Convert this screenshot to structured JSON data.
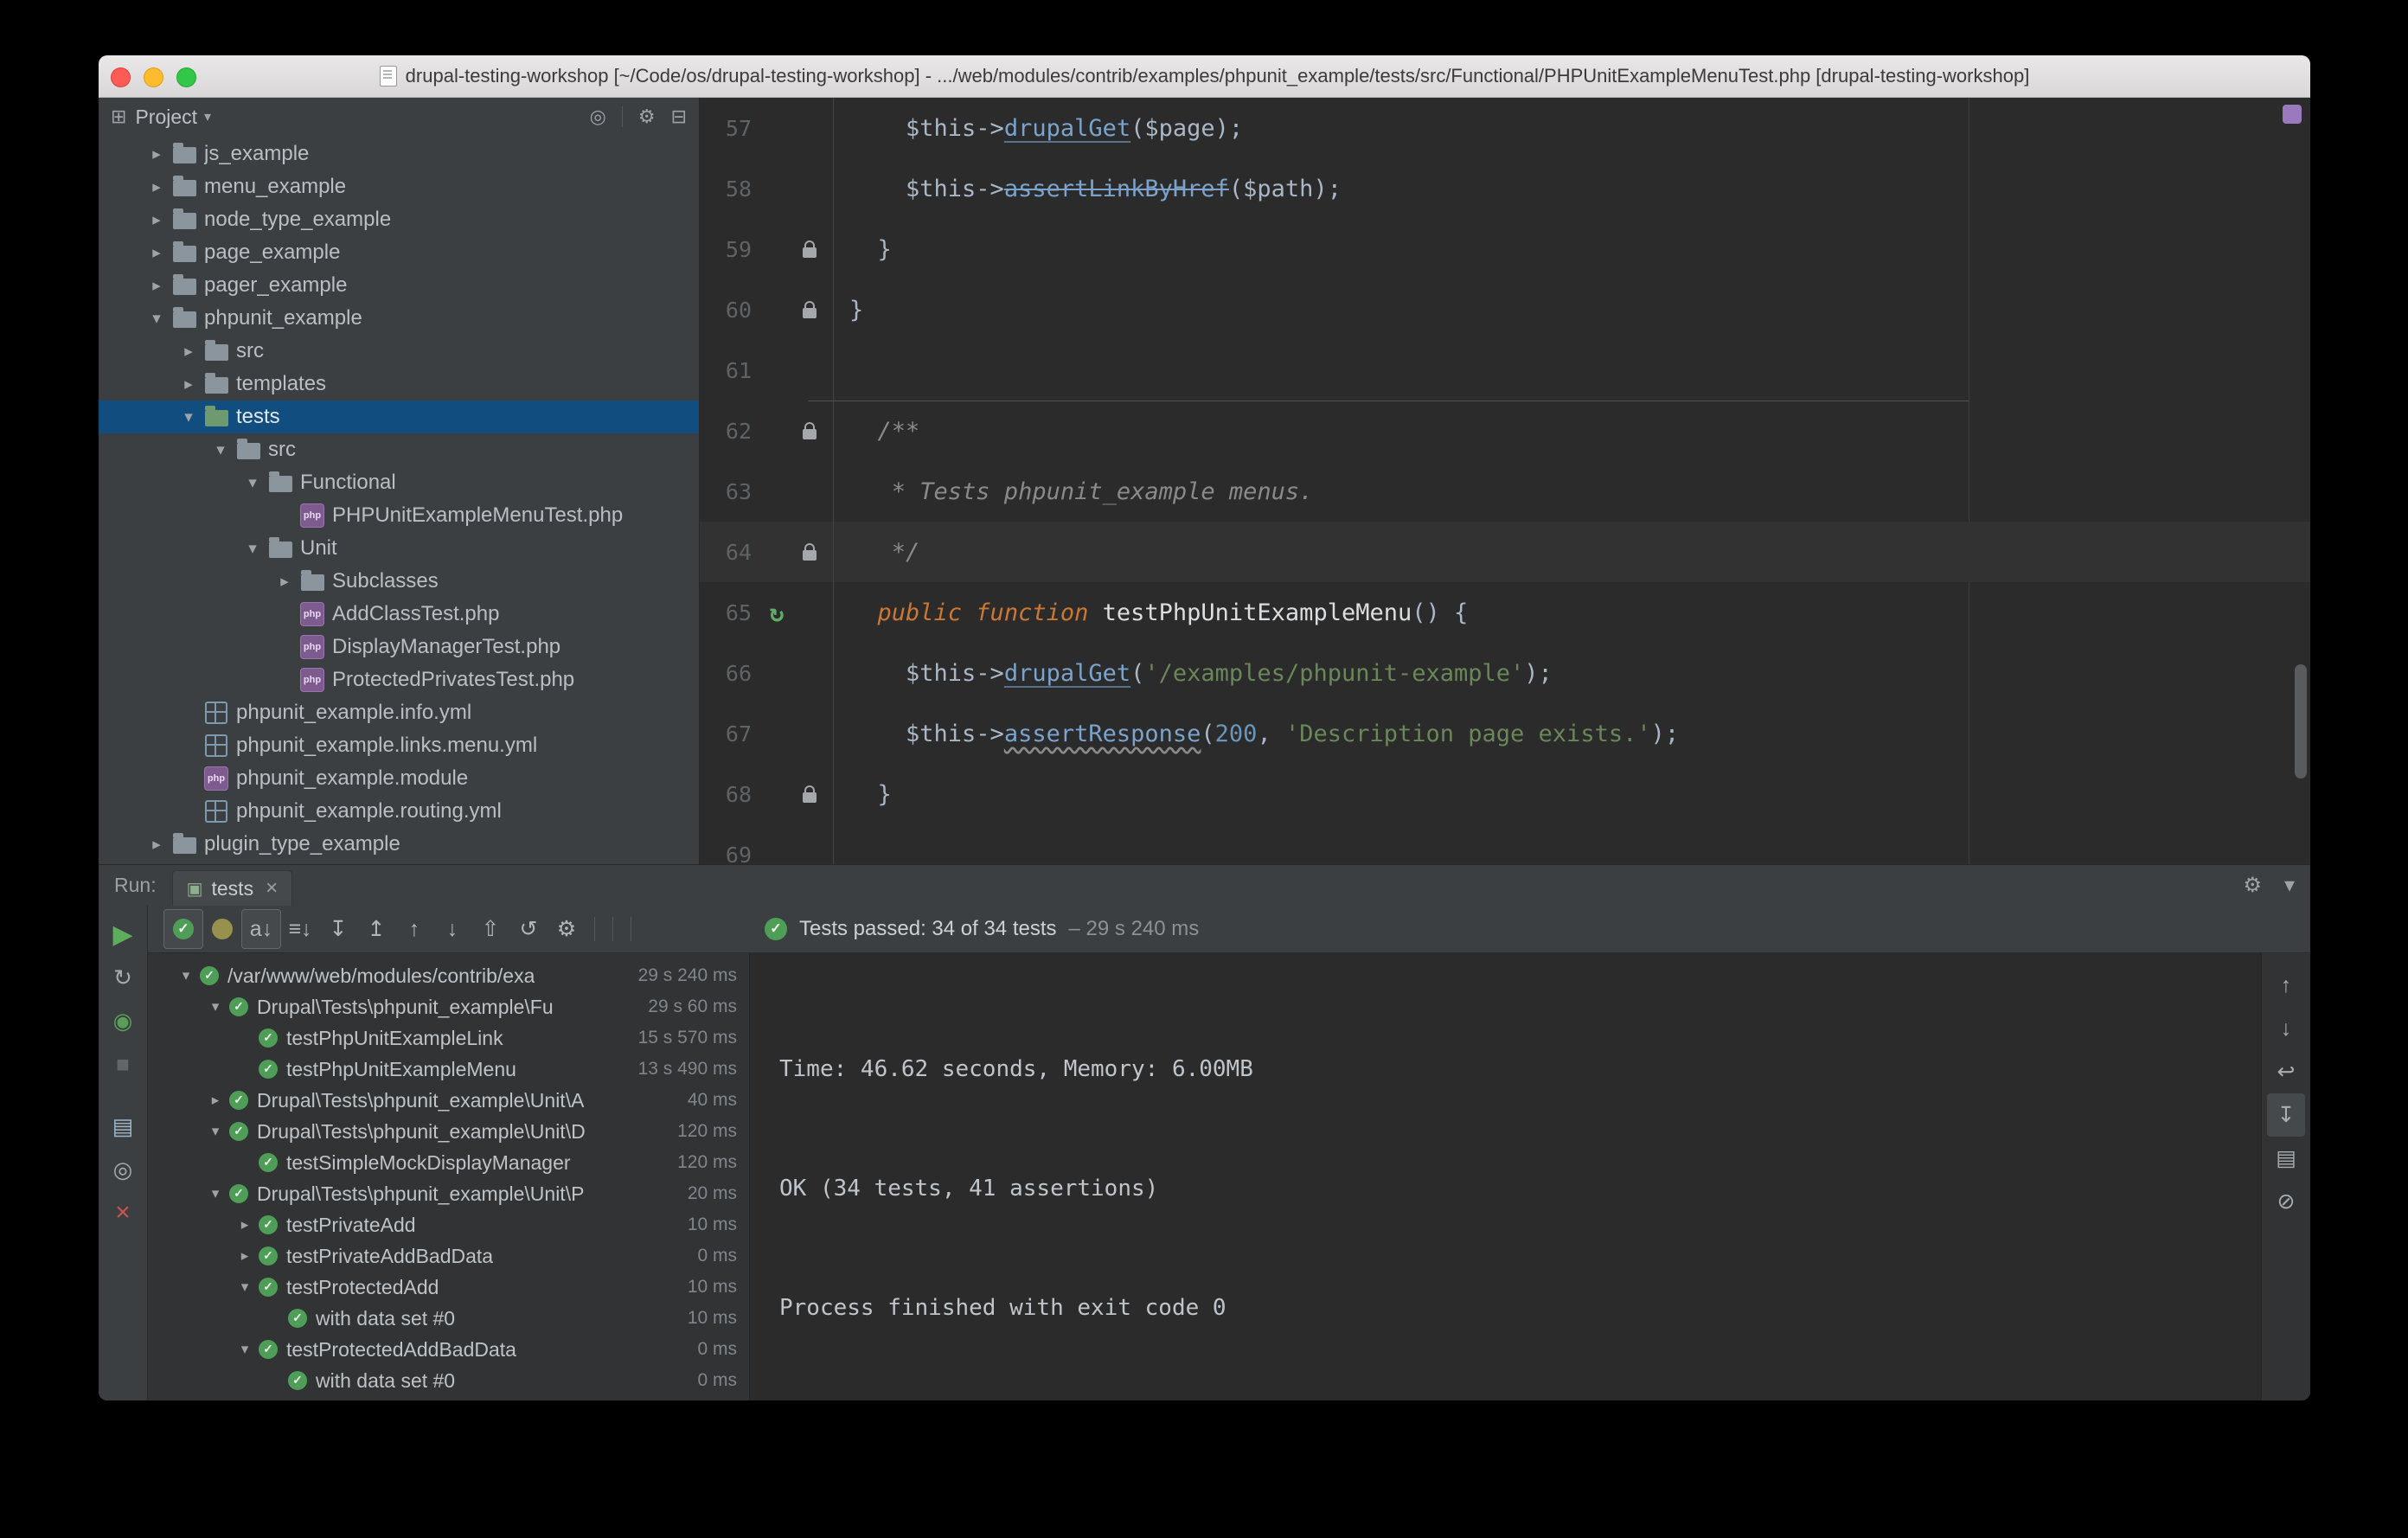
{
  "window": {
    "title": "drupal-testing-workshop [~/Code/os/drupal-testing-workshop] - .../web/modules/contrib/examples/phpunit_example/tests/src/Functional/PHPUnitExampleMenuTest.php [drupal-testing-workshop]"
  },
  "project_panel": {
    "title": "Project",
    "header_icons": [
      {
        "name": "select-opened-file-button",
        "glyph": "◎"
      },
      {
        "name": "separator"
      },
      {
        "name": "settings-gear-button",
        "glyph": "⚙"
      },
      {
        "name": "hide-panel-button",
        "glyph": "⊟"
      }
    ],
    "tree": [
      {
        "label": "js_example",
        "icon": "folder",
        "level": 0,
        "arrow": "collapsed"
      },
      {
        "label": "menu_example",
        "icon": "folder",
        "level": 0,
        "arrow": "collapsed"
      },
      {
        "label": "node_type_example",
        "icon": "folder",
        "level": 0,
        "arrow": "collapsed"
      },
      {
        "label": "page_example",
        "icon": "folder",
        "level": 0,
        "arrow": "collapsed"
      },
      {
        "label": "pager_example",
        "icon": "folder",
        "level": 0,
        "arrow": "collapsed"
      },
      {
        "label": "phpunit_example",
        "icon": "folder",
        "level": 0,
        "arrow": "expanded"
      },
      {
        "label": "src",
        "icon": "folder",
        "level": 1,
        "arrow": "collapsed"
      },
      {
        "label": "templates",
        "icon": "folder",
        "level": 1,
        "arrow": "collapsed"
      },
      {
        "label": "tests",
        "icon": "folder-test",
        "level": 1,
        "arrow": "expanded",
        "selected": true
      },
      {
        "label": "src",
        "icon": "folder",
        "level": 2,
        "arrow": "expanded"
      },
      {
        "label": "Functional",
        "icon": "folder",
        "level": 3,
        "arrow": "expanded"
      },
      {
        "label": "PHPUnitExampleMenuTest.php",
        "icon": "php",
        "level": 4,
        "arrow": null
      },
      {
        "label": "Unit",
        "icon": "folder",
        "level": 3,
        "arrow": "expanded"
      },
      {
        "label": "Subclasses",
        "icon": "folder",
        "level": 4,
        "arrow": "collapsed"
      },
      {
        "label": "AddClassTest.php",
        "icon": "php",
        "level": 4,
        "arrow": null
      },
      {
        "label": "DisplayManagerTest.php",
        "icon": "php",
        "level": 4,
        "arrow": null
      },
      {
        "label": "ProtectedPrivatesTest.php",
        "icon": "php",
        "level": 4,
        "arrow": null
      },
      {
        "label": "phpunit_example.info.yml",
        "icon": "yml",
        "level": 1,
        "arrow": null
      },
      {
        "label": "phpunit_example.links.menu.yml",
        "icon": "yml",
        "level": 1,
        "arrow": null
      },
      {
        "label": "phpunit_example.module",
        "icon": "php",
        "level": 1,
        "arrow": null
      },
      {
        "label": "phpunit_example.routing.yml",
        "icon": "yml",
        "level": 1,
        "arrow": null
      },
      {
        "label": "plugin_type_example",
        "icon": "folder",
        "level": 0,
        "arrow": "collapsed"
      }
    ]
  },
  "editor": {
    "margin_column": 80,
    "lines": [
      {
        "num": "57",
        "icon": null,
        "tokens": [
          [
            "    $this->",
            "plain"
          ],
          [
            "drupalGet",
            "method"
          ],
          [
            "($page);",
            "plain"
          ]
        ]
      },
      {
        "num": "58",
        "icon": null,
        "tokens": [
          [
            "    $this->",
            "plain"
          ],
          [
            "assertLinkByHref",
            "dep"
          ],
          [
            "($path);",
            "plain"
          ]
        ]
      },
      {
        "num": "59",
        "icon": "lock",
        "tokens": [
          [
            "  }",
            "plain"
          ]
        ]
      },
      {
        "num": "60",
        "icon": "lock",
        "tokens": [
          [
            "}",
            "plain"
          ]
        ]
      },
      {
        "num": "61",
        "icon": null,
        "tokens": []
      },
      {
        "num": "62",
        "icon": "lock",
        "sep": true,
        "tokens": [
          [
            "  /**",
            "comment"
          ]
        ]
      },
      {
        "num": "63",
        "icon": null,
        "tokens": [
          [
            "   * Tests phpunit_example menus.",
            "comment"
          ]
        ]
      },
      {
        "num": "64",
        "icon": "lock",
        "current": true,
        "tokens": [
          [
            "   */",
            "comment"
          ]
        ]
      },
      {
        "num": "65",
        "icon": "run",
        "tokens": [
          [
            "  ",
            "plain"
          ],
          [
            "public function ",
            "kw"
          ],
          [
            "testPhpUnitExampleMenu",
            "decl"
          ],
          [
            "() {",
            "plain"
          ]
        ]
      },
      {
        "num": "66",
        "icon": null,
        "tokens": [
          [
            "    $this->",
            "plain"
          ],
          [
            "drupalGet",
            "method"
          ],
          [
            "(",
            "plain"
          ],
          [
            "'/examples/phpunit-example'",
            "str"
          ],
          [
            ");",
            "plain"
          ]
        ]
      },
      {
        "num": "67",
        "icon": null,
        "tokens": [
          [
            "    $this->",
            "plain"
          ],
          [
            "assertResponse",
            "warn"
          ],
          [
            "(",
            "plain"
          ],
          [
            "200",
            "num"
          ],
          [
            ", ",
            "plain"
          ],
          [
            "'Description page exists.'",
            "str"
          ],
          [
            ");",
            "plain"
          ]
        ]
      },
      {
        "num": "68",
        "icon": "lock",
        "tokens": [
          [
            "  }",
            "plain"
          ]
        ]
      },
      {
        "num": "69",
        "icon": null,
        "tokens": []
      }
    ]
  },
  "run_bar": {
    "label": "Run:",
    "tab": {
      "label": "tests",
      "close": "×"
    },
    "icons": [
      {
        "name": "settings-gear-button",
        "glyph": "⚙"
      },
      {
        "name": "hide-panel-button",
        "glyph": "▾"
      }
    ]
  },
  "run_toolbar": {
    "icons": [
      {
        "name": "show-passed-button",
        "shape": "pass",
        "active": true
      },
      {
        "name": "show-ignored-button",
        "shape": "ignored"
      },
      {
        "name": "separator"
      },
      {
        "name": "sort-alphabetically-button",
        "glyph": "a↓",
        "active": true
      },
      {
        "name": "sort-by-duration-button",
        "glyph": "≡↓"
      },
      {
        "name": "separator"
      },
      {
        "name": "expand-all-button",
        "glyph": "↧"
      },
      {
        "name": "collapse-all-button",
        "glyph": "↥"
      },
      {
        "name": "separator"
      },
      {
        "name": "previous-failed-test-button",
        "glyph": "↑"
      },
      {
        "name": "next-failed-test-button",
        "glyph": "↓"
      },
      {
        "name": "import-test-results-button",
        "glyph": "⇧"
      },
      {
        "name": "test-history-button",
        "glyph": "↺"
      },
      {
        "name": "settings-gear-button",
        "glyph": "⚙"
      }
    ],
    "status": {
      "text": "Tests passed: 34 of 34 tests",
      "duration": "– 29 s 240 ms"
    }
  },
  "run_stripe": {
    "icons": [
      {
        "name": "rerun-tests-button",
        "glyph": "▶",
        "color": "#5cad5c",
        "size": "30px"
      },
      {
        "name": "rerun-failed-tests-button",
        "glyph": "↻",
        "color": "#a7aaad"
      },
      {
        "name": "toggle-auto-test-button",
        "glyph": "◉",
        "color": "#5a9e5a"
      },
      {
        "name": "stop-button",
        "glyph": "■",
        "color": "#616669"
      },
      {
        "name": "spacer"
      },
      {
        "name": "console-button",
        "glyph": "▤",
        "color": "#9fb6c9"
      },
      {
        "name": "pin-tab-button",
        "glyph": "◎",
        "color": "#a7aaad"
      },
      {
        "name": "close-button",
        "glyph": "×",
        "color": "#c75450",
        "size": "30px"
      }
    ]
  },
  "test_tree": [
    {
      "level": 0,
      "arrow": "expanded",
      "label": "/var/www/web/modules/contrib/exa",
      "duration": "29 s 240 ms"
    },
    {
      "level": 1,
      "arrow": "expanded",
      "label": "Drupal\\Tests\\phpunit_example\\Fu",
      "duration": "29 s 60 ms"
    },
    {
      "level": 2,
      "arrow": null,
      "label": "testPhpUnitExampleLink",
      "duration": "15 s 570 ms"
    },
    {
      "level": 2,
      "arrow": null,
      "label": "testPhpUnitExampleMenu",
      "duration": "13 s 490 ms"
    },
    {
      "level": 1,
      "arrow": "collapsed",
      "label": "Drupal\\Tests\\phpunit_example\\Unit\\A",
      "duration": "40 ms"
    },
    {
      "level": 1,
      "arrow": "expanded",
      "label": "Drupal\\Tests\\phpunit_example\\Unit\\D",
      "duration": "120 ms"
    },
    {
      "level": 2,
      "arrow": null,
      "label": "testSimpleMockDisplayManager",
      "duration": "120 ms"
    },
    {
      "level": 1,
      "arrow": "expanded",
      "label": "Drupal\\Tests\\phpunit_example\\Unit\\P",
      "duration": "20 ms"
    },
    {
      "level": 2,
      "arrow": "collapsed",
      "label": "testPrivateAdd",
      "duration": "10 ms"
    },
    {
      "level": 2,
      "arrow": "collapsed",
      "label": "testPrivateAddBadData",
      "duration": "0 ms"
    },
    {
      "level": 2,
      "arrow": "expanded",
      "label": "testProtectedAdd",
      "duration": "10 ms"
    },
    {
      "level": 3,
      "arrow": null,
      "label": "with data set #0",
      "duration": "10 ms"
    },
    {
      "level": 2,
      "arrow": "expanded",
      "label": "testProtectedAddBadData",
      "duration": "0 ms"
    },
    {
      "level": 3,
      "arrow": null,
      "label": "with data set #0",
      "duration": "0 ms"
    }
  ],
  "console": {
    "lines": [
      "Time: 46.62 seconds, Memory: 6.00MB",
      "",
      "OK (34 tests, 41 assertions)",
      "",
      "Process finished with exit code 0"
    ]
  },
  "console_rail": {
    "icons": [
      {
        "name": "up-the-stack-trace-button",
        "glyph": "↑"
      },
      {
        "name": "down-the-stack-trace-button",
        "glyph": "↓"
      },
      {
        "name": "soft-wrap-button",
        "glyph": "↩"
      },
      {
        "name": "scroll-to-end-button",
        "glyph": "↧",
        "active": true
      },
      {
        "name": "print-button",
        "glyph": "▤"
      },
      {
        "name": "clear-output-button",
        "glyph": "⊘"
      }
    ]
  }
}
